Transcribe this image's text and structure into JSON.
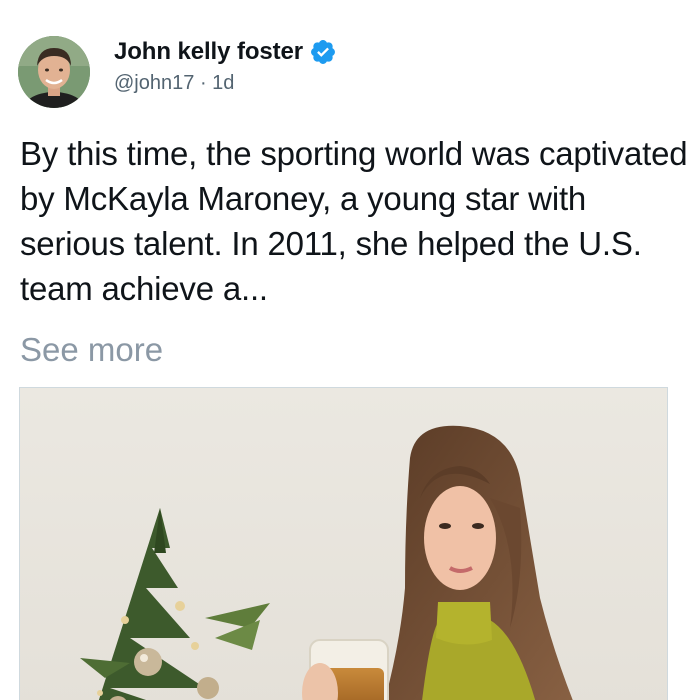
{
  "author": {
    "name": "John kelly foster",
    "handle": "@john17",
    "separator": "·",
    "time": "1d",
    "verified_icon": "verified-badge-icon",
    "verified_color": "#1d9bf0"
  },
  "post": {
    "text": "By this time, the sporting world was captivated by McKayla Maroney, a young star with serious talent. In 2011, she helped the U.S. team achieve a...",
    "see_more": "See more"
  },
  "colors": {
    "text": "#0f1419",
    "secondary": "#536471",
    "see_more": "#8b98a5",
    "border": "#cfd9de"
  }
}
